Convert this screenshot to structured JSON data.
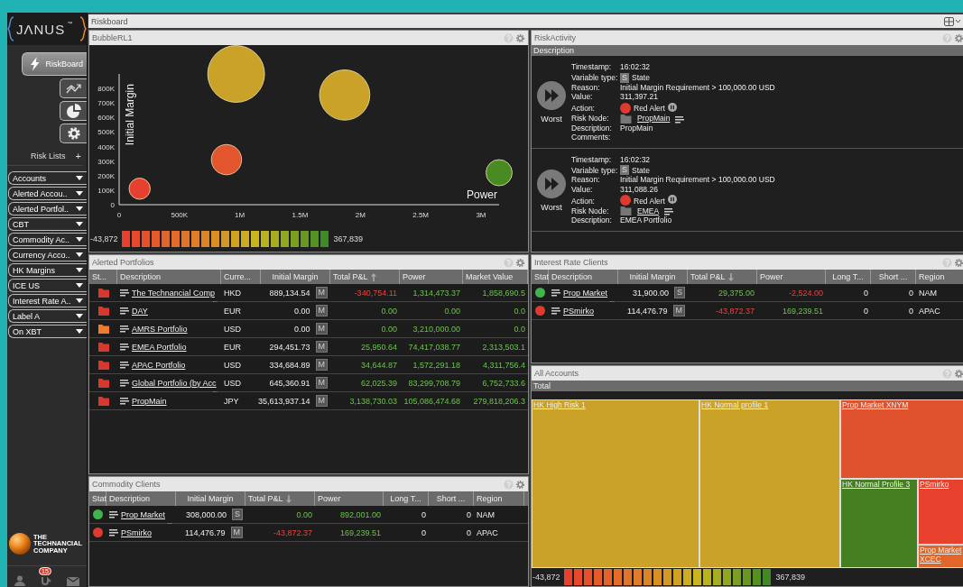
{
  "sidebar": {
    "logo": "JΛNUS",
    "logo_mark": "™",
    "nav": [
      {
        "label": "RiskBoard",
        "selected": true
      },
      {
        "selected": false
      },
      {
        "selected": false
      },
      {
        "selected": false
      }
    ],
    "risk_lists": {
      "title": "Risk Lists",
      "add": "+",
      "items": [
        "Accounts",
        "Alerted Accou..",
        "Alerted Portfol..",
        "CBT",
        "Commodity Ac..",
        "Currency Acco..",
        "HK Margins",
        "ICE US",
        "Interest Rate A..",
        "Label A",
        "On XBT"
      ]
    },
    "company": "THE TECHNANCIAL COMPANY",
    "notifications": "15"
  },
  "workspace": {
    "title": "Riskboard"
  },
  "bubble_panel": {
    "title": "BubbleRL1",
    "chart_data": {
      "type": "scatter",
      "xlabel": "Power",
      "ylabel": "Initial Margin",
      "x": [
        170000,
        890000,
        970000,
        1870000,
        3150000
      ],
      "series": [
        {
          "color": "#e8402e",
          "values": [
            110000,
            null,
            null,
            null,
            null
          ]
        },
        {
          "color": "#e2552d",
          "values": [
            null,
            310000,
            null,
            null,
            null
          ]
        },
        {
          "color": "#c9a227",
          "values": [
            null,
            null,
            900000,
            755000,
            null
          ]
        },
        {
          "color": "#4a8a22",
          "values": [
            null,
            null,
            null,
            null,
            220000
          ]
        }
      ],
      "xlim": [
        0,
        3150000
      ],
      "ylim": [
        0,
        900000
      ],
      "xticks": [
        {
          "value": 0,
          "label": "0"
        },
        {
          "value": 500000,
          "label": "500K"
        },
        {
          "value": 1000000,
          "label": "1M"
        },
        {
          "value": 1500000,
          "label": "1.5M"
        },
        {
          "value": 2000000,
          "label": "2M"
        },
        {
          "value": 2500000,
          "label": "2.5M"
        },
        {
          "value": 3000000,
          "label": "3M"
        }
      ],
      "yticks": [
        {
          "value": 0,
          "label": "0"
        },
        {
          "value": 100000,
          "label": "100K"
        },
        {
          "value": 200000,
          "label": "200K"
        },
        {
          "value": 300000,
          "label": "300K"
        },
        {
          "value": 400000,
          "label": "400K"
        },
        {
          "value": 500000,
          "label": "500K"
        },
        {
          "value": 600000,
          "label": "600K"
        },
        {
          "value": 700000,
          "label": "700K"
        },
        {
          "value": 800000,
          "label": "800K"
        }
      ]
    },
    "scale": {
      "min": "-43,872",
      "max": "367,839"
    }
  },
  "risk_activity": {
    "title": "RiskActivity",
    "column": "Description",
    "alerts": [
      {
        "rank": "Worst",
        "fields": [
          {
            "kind": "text",
            "label": "Timestamp:",
            "value": "16:02:32"
          },
          {
            "kind": "badge",
            "label": "Variable type:",
            "badge": "S",
            "value": "State"
          },
          {
            "kind": "text",
            "label": "Reason:",
            "value": "Initial Margin Requirement > 100,000.00 USD"
          },
          {
            "kind": "text",
            "label": "Value:",
            "value": "311,397.21"
          },
          {
            "kind": "action",
            "label": "Action:",
            "value": "Red Alert",
            "color": "#e03a2e"
          },
          {
            "kind": "node",
            "label": "Risk Node:",
            "value": "PropMain"
          },
          {
            "kind": "text",
            "label": "Description:",
            "value": "PropMain"
          },
          {
            "kind": "text",
            "label": "Comments:"
          }
        ]
      },
      {
        "rank": "Worst",
        "fields": [
          {
            "kind": "text",
            "label": "Timestamp:",
            "value": "16:02:32"
          },
          {
            "kind": "badge",
            "label": "Variable type:",
            "badge": "S",
            "value": "State"
          },
          {
            "kind": "text",
            "label": "Reason:",
            "value": "Initial Margin Requirement > 100,000.00 USD"
          },
          {
            "kind": "text",
            "label": "Value:",
            "value": "311,088.26"
          },
          {
            "kind": "action",
            "label": "Action:",
            "value": "Red Alert",
            "color": "#e03a2e"
          },
          {
            "kind": "node",
            "label": "Risk Node:",
            "value": "EMEA"
          },
          {
            "kind": "text",
            "label": "Description:",
            "value": "EMEA Portfolio"
          }
        ]
      }
    ]
  },
  "alerted_portfolios": {
    "title": "Alerted Portfolios",
    "columns": [
      {
        "label": "St...",
        "sorted": false
      },
      {
        "label": "Description",
        "sorted": false
      },
      {
        "label": "Curre...",
        "sorted": false
      },
      {
        "label": "Initial Margin",
        "sorted": false
      },
      {
        "label": "Total P&L",
        "sorted": true,
        "descending": false
      },
      {
        "label": "Power",
        "sorted": false
      },
      {
        "label": "Market Value",
        "sorted": false
      }
    ],
    "rows": [
      {
        "cells": [
          {
            "kind": "folder",
            "color": "#d63a2f"
          },
          {
            "kind": "link",
            "text": "The Technancial Comp",
            "more": "..."
          },
          {
            "kind": "text",
            "text": "HKD"
          },
          {
            "kind": "amount",
            "text": "889,134.54",
            "badge": "M"
          },
          {
            "kind": "loss",
            "text": "-340,754.11"
          },
          {
            "kind": "gain",
            "text": "1,314,473.37"
          },
          {
            "kind": "gain",
            "text": "1,858,690.5"
          }
        ]
      },
      {
        "cells": [
          {
            "kind": "folder",
            "color": "#d63a2f"
          },
          {
            "kind": "link",
            "text": "DAY"
          },
          {
            "kind": "text",
            "text": "EUR"
          },
          {
            "kind": "amount",
            "text": "0.00",
            "badge": "M"
          },
          {
            "kind": "gain",
            "text": "0.00"
          },
          {
            "kind": "gain",
            "text": "0.00"
          },
          {
            "kind": "gain",
            "text": "0.0"
          }
        ]
      },
      {
        "cells": [
          {
            "kind": "folder",
            "color": "#f07c2a"
          },
          {
            "kind": "link",
            "text": "AMRS Portfolio"
          },
          {
            "kind": "text",
            "text": "USD"
          },
          {
            "kind": "amount",
            "text": "0.00",
            "badge": "M"
          },
          {
            "kind": "gain",
            "text": "0.00"
          },
          {
            "kind": "gain",
            "text": "3,210,000.00"
          },
          {
            "kind": "gain",
            "text": "0.0"
          }
        ]
      },
      {
        "cells": [
          {
            "kind": "folder",
            "color": "#d63a2f"
          },
          {
            "kind": "link",
            "text": "EMEA Portfolio"
          },
          {
            "kind": "text",
            "text": "EUR"
          },
          {
            "kind": "amount",
            "text": "294,451.73",
            "badge": "M"
          },
          {
            "kind": "gain",
            "text": "25,950.64"
          },
          {
            "kind": "gain",
            "text": "74,417,038.77"
          },
          {
            "kind": "gain",
            "text": "2,313,503.1"
          }
        ]
      },
      {
        "cells": [
          {
            "kind": "folder",
            "color": "#d63a2f"
          },
          {
            "kind": "link",
            "text": "APAC Portfolio"
          },
          {
            "kind": "text",
            "text": "USD"
          },
          {
            "kind": "amount",
            "text": "334,684.89",
            "badge": "M"
          },
          {
            "kind": "gain",
            "text": "34,644.87"
          },
          {
            "kind": "gain",
            "text": "1,572,291.18"
          },
          {
            "kind": "gain",
            "text": "4,311,756.4"
          }
        ]
      },
      {
        "cells": [
          {
            "kind": "folder",
            "color": "#d63a2f"
          },
          {
            "kind": "link",
            "text": "Global Portfolio (by Acc",
            "more": "..."
          },
          {
            "kind": "text",
            "text": "USD"
          },
          {
            "kind": "amount",
            "text": "645,360.91",
            "badge": "M"
          },
          {
            "kind": "gain",
            "text": "62,025.39"
          },
          {
            "kind": "gain",
            "text": "83,299,708.79"
          },
          {
            "kind": "gain",
            "text": "6,752,733.6"
          }
        ]
      },
      {
        "cells": [
          {
            "kind": "folder",
            "color": "#d63a2f"
          },
          {
            "kind": "link",
            "text": "PropMain"
          },
          {
            "kind": "text",
            "text": "JPY"
          },
          {
            "kind": "amount",
            "text": "35,613,937.14",
            "badge": "M"
          },
          {
            "kind": "gain",
            "text": "3,138,730.03"
          },
          {
            "kind": "gain",
            "text": "105,086,474.68"
          },
          {
            "kind": "gain",
            "text": "279,818,206.3"
          }
        ]
      }
    ]
  },
  "commodity_clients": {
    "title": "Commodity Clients",
    "columns": [
      {
        "label": "Stat",
        "sorted": false
      },
      {
        "label": "Description",
        "sorted": false
      },
      {
        "label": "Initial Margin",
        "sorted": false
      },
      {
        "label": "Total P&L",
        "sorted": true,
        "descending": true
      },
      {
        "label": "Power",
        "sorted": false
      },
      {
        "label": "Long T...",
        "sorted": false
      },
      {
        "label": "Short ...",
        "sorted": false
      },
      {
        "label": "Region",
        "sorted": false
      }
    ],
    "rows": [
      {
        "cells": [
          {
            "kind": "dot",
            "color": "#3db54a"
          },
          {
            "kind": "link",
            "text": "Prop Market",
            "more": "..."
          },
          {
            "kind": "amount",
            "text": "308,000.00",
            "badge": "S"
          },
          {
            "kind": "gain",
            "text": "0.00"
          },
          {
            "kind": "gain",
            "text": "892,001.00"
          },
          {
            "kind": "num",
            "text": "0"
          },
          {
            "kind": "num",
            "text": "0"
          },
          {
            "kind": "text",
            "text": "NAM"
          }
        ]
      },
      {
        "cells": [
          {
            "kind": "dot",
            "color": "#e0392e"
          },
          {
            "kind": "link",
            "text": "PSmirko"
          },
          {
            "kind": "amount",
            "text": "114,476.79",
            "badge": "M"
          },
          {
            "kind": "loss",
            "text": "-43,872.37"
          },
          {
            "kind": "gain",
            "text": "169,239.51"
          },
          {
            "kind": "num",
            "text": "0"
          },
          {
            "kind": "num",
            "text": "0"
          },
          {
            "kind": "text",
            "text": "APAC"
          }
        ]
      }
    ]
  },
  "interest_rate_clients": {
    "title": "Interest Rate Clients",
    "columns": [
      {
        "label": "Stat",
        "sorted": false
      },
      {
        "label": "Description",
        "sorted": false
      },
      {
        "label": "Initial Margin",
        "sorted": false
      },
      {
        "label": "Total P&L",
        "sorted": true,
        "descending": true
      },
      {
        "label": "Power",
        "sorted": false
      },
      {
        "label": "Long T...",
        "sorted": false
      },
      {
        "label": "Short ...",
        "sorted": false
      },
      {
        "label": "Region",
        "sorted": false
      }
    ],
    "rows": [
      {
        "cells": [
          {
            "kind": "dot",
            "color": "#3db54a"
          },
          {
            "kind": "link",
            "text": "Prop Market",
            "more": "..."
          },
          {
            "kind": "amount",
            "text": "31,900.00",
            "badge": "S"
          },
          {
            "kind": "gain",
            "text": "29,375.00"
          },
          {
            "kind": "loss",
            "text": "-2,524.00"
          },
          {
            "kind": "num",
            "text": "0"
          },
          {
            "kind": "num",
            "text": "0"
          },
          {
            "kind": "text",
            "text": "NAM"
          }
        ]
      },
      {
        "cells": [
          {
            "kind": "dot",
            "color": "#e0392e"
          },
          {
            "kind": "link",
            "text": "PSmirko"
          },
          {
            "kind": "amount",
            "text": "114,476.79",
            "badge": "M"
          },
          {
            "kind": "loss",
            "text": "-43,872.37"
          },
          {
            "kind": "gain",
            "text": "169,239.51"
          },
          {
            "kind": "num",
            "text": "0"
          },
          {
            "kind": "num",
            "text": "0"
          },
          {
            "kind": "text",
            "text": "APAC"
          }
        ]
      }
    ]
  },
  "all_accounts": {
    "title": "All Accounts",
    "root": "Total",
    "tiles": [
      {
        "label": "HK High Risk 1",
        "color": "#c9a227"
      },
      {
        "label": "HK Normal profile 1",
        "color": "#c9a227"
      },
      {
        "label": "Prop Market XNYM",
        "color": "#e0522e"
      },
      {
        "label": "HK Normal Profile 3",
        "color": "#467f22"
      },
      {
        "label": "PSmirko",
        "color": "#e8412e"
      },
      {
        "label": "Prop Market XCEC",
        "color": "#e0662a"
      }
    ],
    "scale": {
      "min": "-43,872",
      "max": "367,839"
    }
  }
}
